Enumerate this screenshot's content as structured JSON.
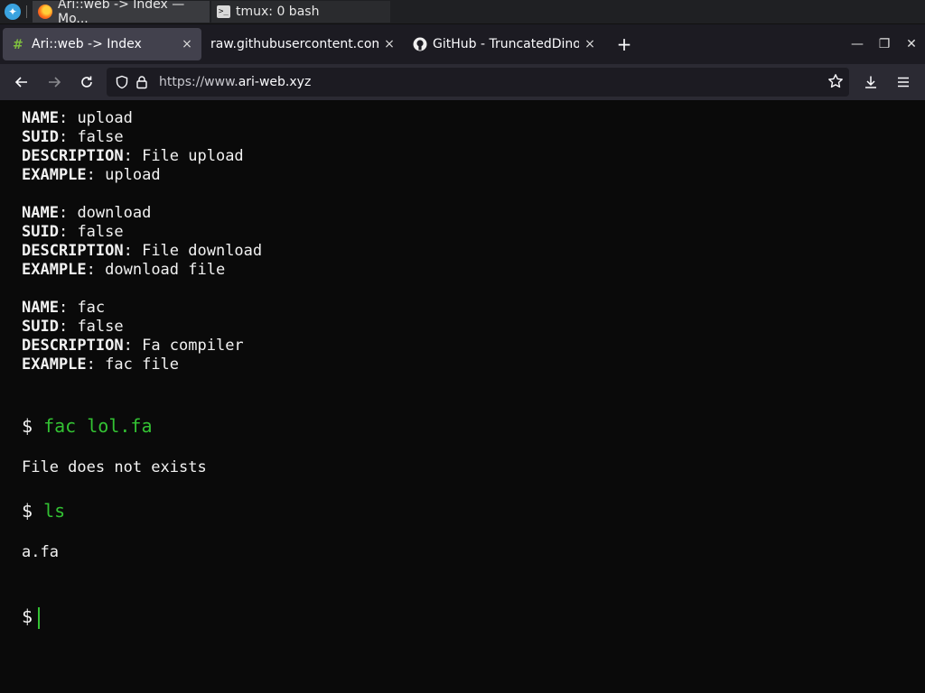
{
  "taskbar": {
    "tasks": [
      {
        "label": "Ari::web -> Index — Mo..."
      },
      {
        "label": "tmux: 0 bash"
      }
    ]
  },
  "browser": {
    "tabs": [
      {
        "label": "Ari::web -> Index",
        "close": "×"
      },
      {
        "label": "raw.githubusercontent.com/",
        "close": "×"
      },
      {
        "label": "GitHub - TruncatedDinosa",
        "close": "×"
      }
    ],
    "new_tab": "+",
    "url": {
      "scheme": "https://www.",
      "host": "ari-web.xyz"
    }
  },
  "terminal": {
    "commands": [
      {
        "name_key": "NAME",
        "name": "upload",
        "suid_key": "SUID",
        "suid": "false",
        "desc_key": "DESCRIPTION",
        "desc": "File upload",
        "example_key": "EXAMPLE",
        "example": "upload"
      },
      {
        "name_key": "NAME",
        "name": "download",
        "suid_key": "SUID",
        "suid": "false",
        "desc_key": "DESCRIPTION",
        "desc": "File download",
        "example_key": "EXAMPLE",
        "example": "download file"
      },
      {
        "name_key": "NAME",
        "name": "fac",
        "suid_key": "SUID",
        "suid": "false",
        "desc_key": "DESCRIPTION",
        "desc": "Fa compiler",
        "example_key": "EXAMPLE",
        "example": "fac file"
      }
    ],
    "prompt": "$",
    "session": [
      {
        "command": "fac lol.fa",
        "output": "File does not exists"
      },
      {
        "command": "ls",
        "output": "a.fa"
      }
    ]
  },
  "colors": {
    "accent_green": "#33c233",
    "background": "#0a0a0a",
    "tab_selected": "#42414d"
  }
}
